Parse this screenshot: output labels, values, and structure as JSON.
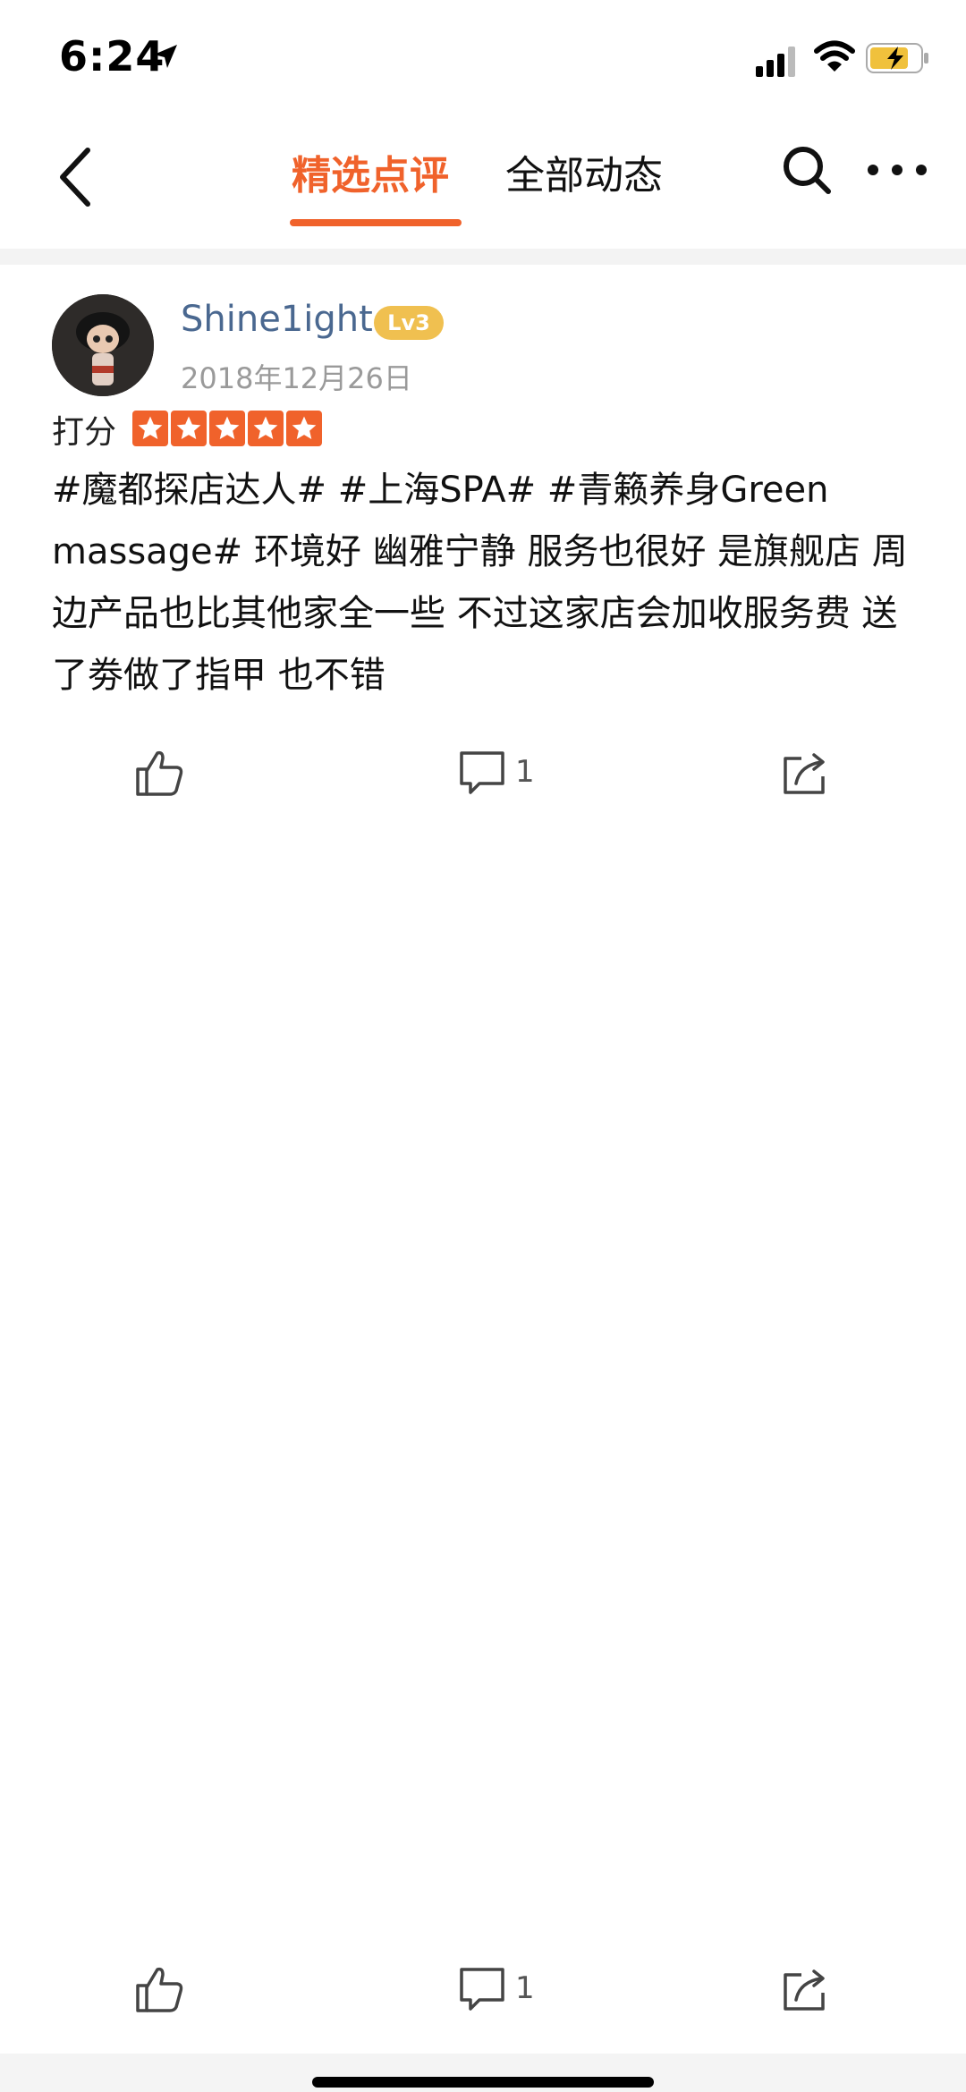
{
  "status": {
    "time": "6:24"
  },
  "nav": {
    "tabs": [
      {
        "label": "精选点评"
      },
      {
        "label": "全部动态"
      }
    ]
  },
  "review": {
    "username": "Shine1ight",
    "level": "Lv3",
    "date": "2018年12月26日",
    "score_label": "打分",
    "rating": 5,
    "text": "#魔都探店达人#  #上海SPA#   #青籁养身Green massage#   环境好 幽雅宁静 服务也很好 是旗舰店 周边产品也比其他家全一些 不过这家店会加收服务费 送了劵做了指甲 也不错",
    "actions": {
      "comment_count": "1"
    }
  },
  "footer_actions": {
    "comment_count": "1"
  },
  "colors": {
    "accent": "#f0622b",
    "username": "#4a6890",
    "level_badge": "#f0c050"
  }
}
